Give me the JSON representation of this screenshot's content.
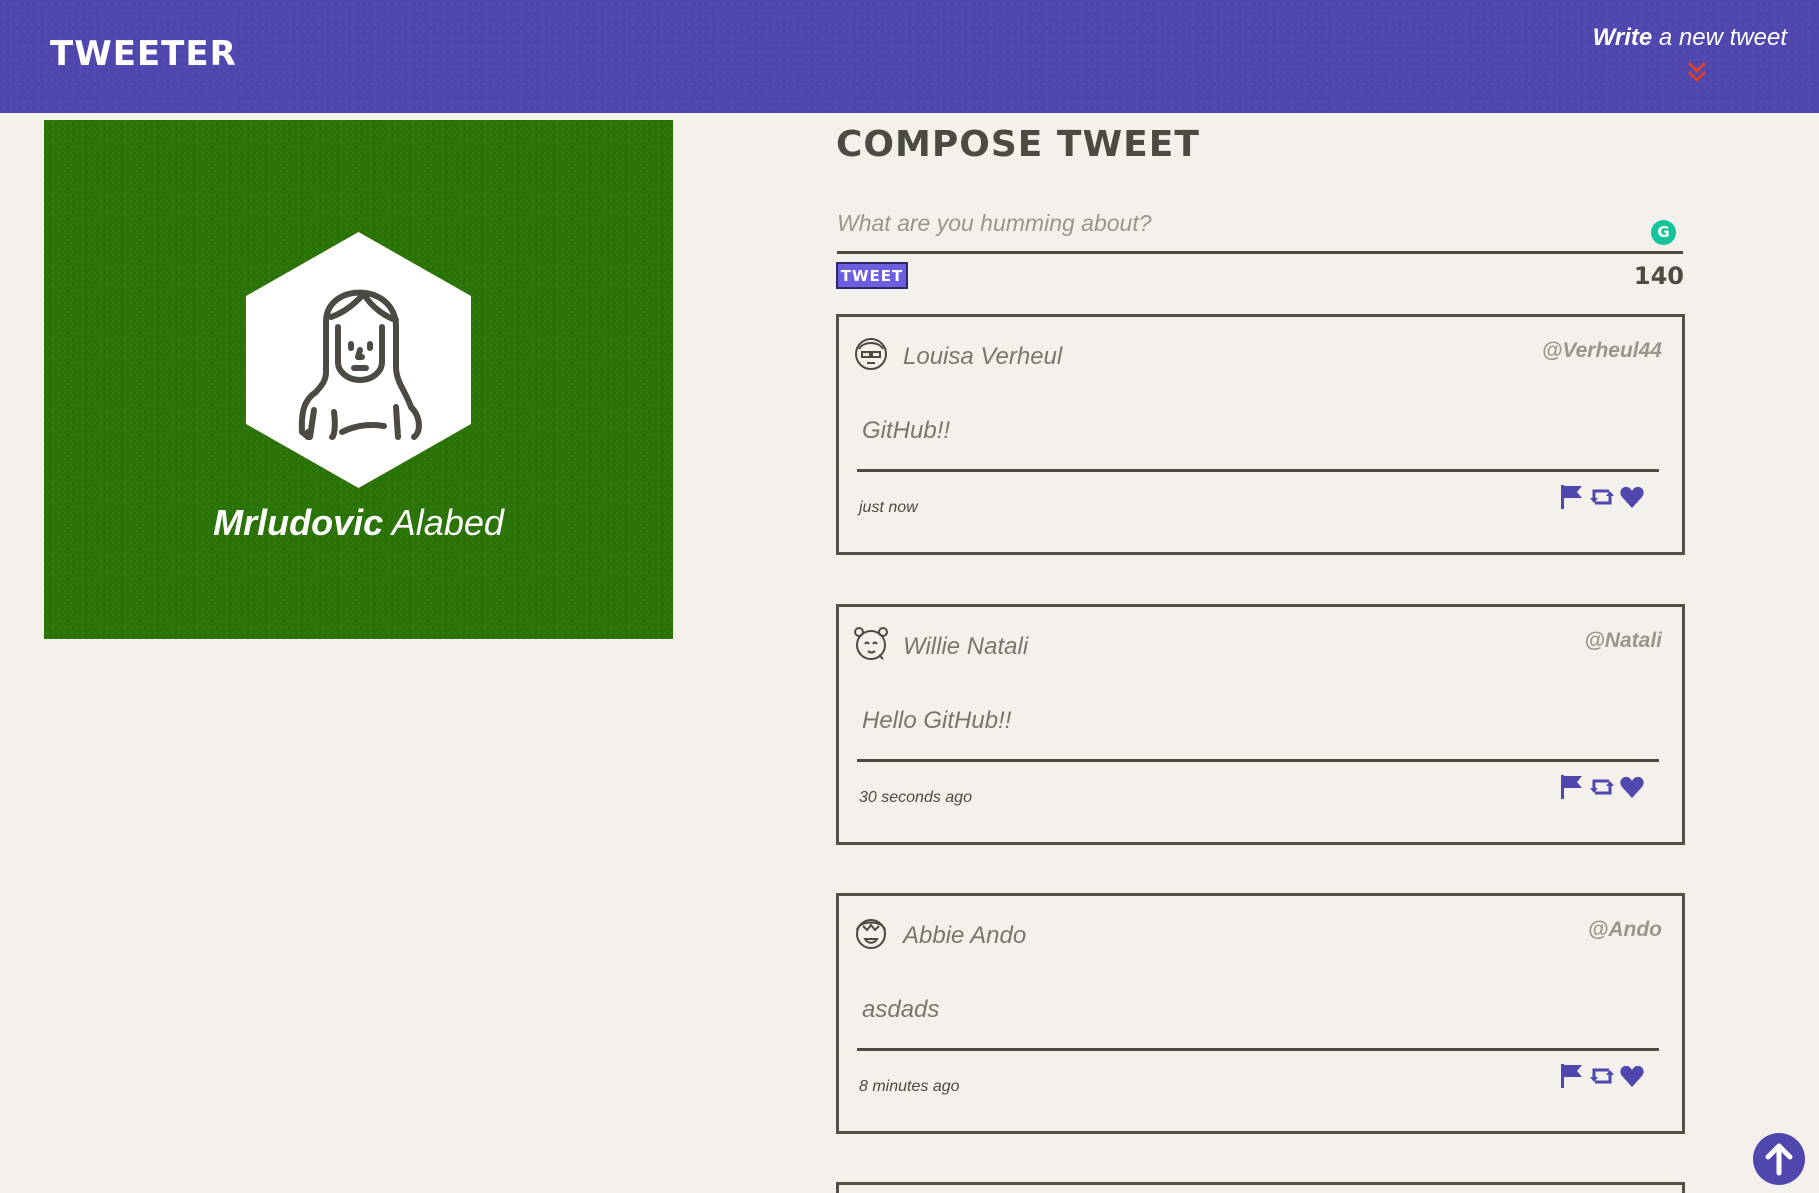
{
  "nav": {
    "brand": "TWEETER",
    "write_strong": "Write",
    "write_rest": " a new tweet",
    "chevron_icon": "double-chevron-down-icon",
    "chevron_color": "#d9402e",
    "background": "#4f47ad"
  },
  "profile": {
    "first_name": "Mrludovic",
    "last_name": " Alabed",
    "background": "#2a7306",
    "avatar_icon": "user-avatar-icon"
  },
  "compose": {
    "title": "COMPOSE TWEET",
    "placeholder": "What are you humming about?",
    "button": "TWEET",
    "counter": "140"
  },
  "tweets": [
    {
      "name": "Louisa Verheul",
      "handle": "@Verheul44",
      "content": "GitHub!!",
      "time": "just now"
    },
    {
      "name": "Willie Natali",
      "handle": "@Natali",
      "content": "Hello GitHub!!",
      "time": "30 seconds ago"
    },
    {
      "name": "Abbie Ando",
      "handle": "@Ando",
      "content": "asdads",
      "time": "8 minutes ago"
    }
  ],
  "colors": {
    "accent": "#4f47ad",
    "text": "#4d4a44",
    "muted": "#7a766f",
    "page_bg": "#f4f1ec"
  },
  "icons": [
    "flag-icon",
    "retweet-icon",
    "heart-icon",
    "arrow-up-icon"
  ]
}
